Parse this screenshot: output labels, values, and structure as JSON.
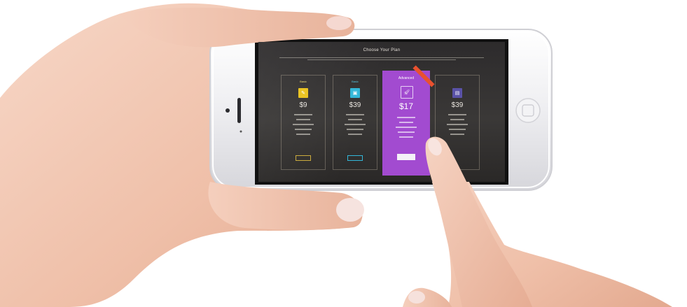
{
  "scene": {
    "device": "smartphone-landscape",
    "icons": [
      "home-button-icon",
      "earpiece-icon",
      "camera-icon"
    ]
  },
  "pricing": {
    "heading": "Choose Your Plan",
    "plans": [
      {
        "name": "Basic",
        "price": "$9",
        "accent": "#e9c21d",
        "icon": "pencil-icon",
        "features": 5
      },
      {
        "name": "Basic",
        "price": "$39",
        "accent": "#33b7d9",
        "icon": "image-icon",
        "features": 5
      },
      {
        "name": "Advanced",
        "price": "$17",
        "accent": "#a24bd0",
        "icon": "rocket-icon",
        "features": 5
      },
      {
        "name": "",
        "price": "$39",
        "accent": "#5a52a8",
        "icon": "briefcase-icon",
        "features": 5
      }
    ]
  },
  "colors": {
    "featured": "#a24bd0",
    "ribbon": "#e9512f",
    "phone_body": "#f4f4f6",
    "skin": "#f3c9b6"
  }
}
